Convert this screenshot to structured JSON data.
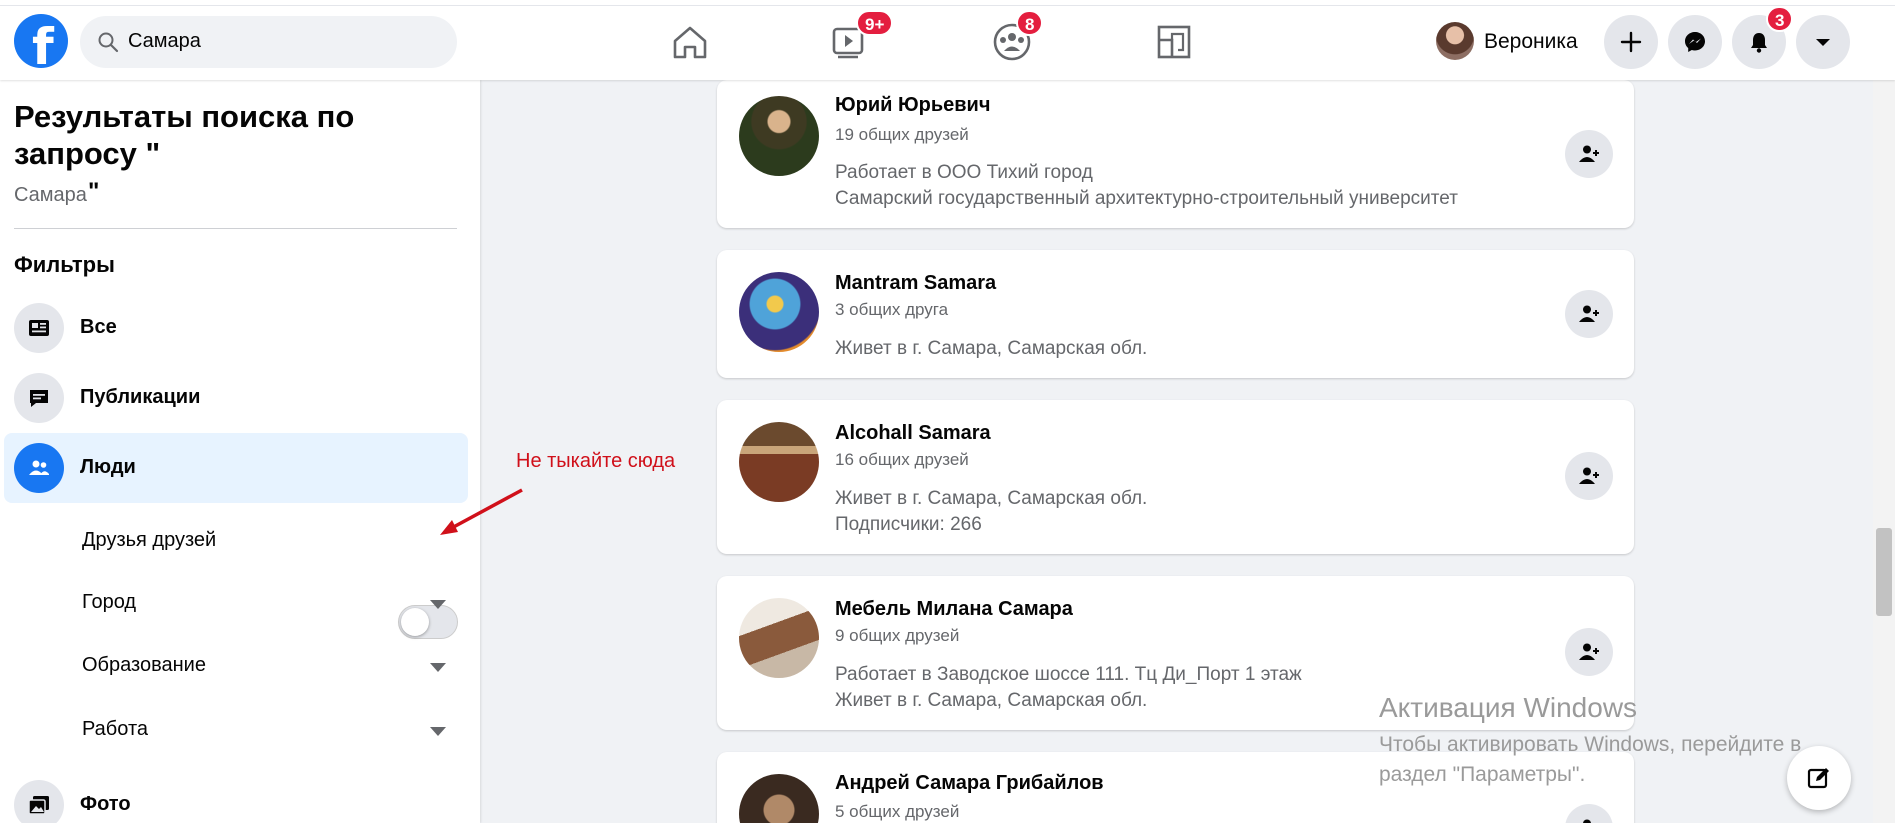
{
  "topbar": {
    "logo_letter": "f",
    "search_value": "Самара",
    "badges": {
      "video": "9+",
      "groups": "8",
      "notifications": "3"
    },
    "user_name": "Вероника"
  },
  "left": {
    "title": "Результаты поиска по запросу \"",
    "query": "Самара",
    "quote": "\"",
    "filters_heading": "Фильтры",
    "items": [
      {
        "label": "Все"
      },
      {
        "label": "Публикации"
      },
      {
        "label": "Люди"
      },
      {
        "label": "Фото"
      }
    ],
    "sub_filters": [
      {
        "label": "Друзья друзей"
      },
      {
        "label": "Город"
      },
      {
        "label": "Образование"
      },
      {
        "label": "Работа"
      }
    ],
    "friends_of_friends_on": false
  },
  "annotation": "Не тыкайте сюда",
  "results": [
    {
      "name": "Юрий Юрьевич",
      "mutual": "19 общих друзей",
      "lines": [
        "Работает в ООО Тихий город",
        "Самарский государственный архитектурно-строительный университет"
      ]
    },
    {
      "name": "Mantram Samara",
      "mutual": "3 общих друга",
      "lines": [
        "Живет в г. Самара, Самарская обл."
      ]
    },
    {
      "name": "Alcohall Samara",
      "mutual": "16 общих друзей",
      "lines": [
        "Живет в г. Самара, Самарская обл.",
        "Подписчики: 266"
      ]
    },
    {
      "name": "Мебель Милана Самара",
      "mutual": "9 общих друзей",
      "lines": [
        "Работает в Заводское шоссе 111. Тц Ди_Порт 1 этаж",
        "Живет в г. Самара, Самарская обл."
      ]
    },
    {
      "name": "Андрей Самара Грибайлов",
      "mutual": "5 общих друзей",
      "lines": []
    }
  ],
  "watermark": {
    "title": "Активация Windows",
    "text": "Чтобы активировать Windows, перейдите в раздел \"Параметры\"."
  },
  "colors": {
    "brand": "#1877f2",
    "badge": "#e41e3f",
    "annotation": "#d0101a"
  }
}
